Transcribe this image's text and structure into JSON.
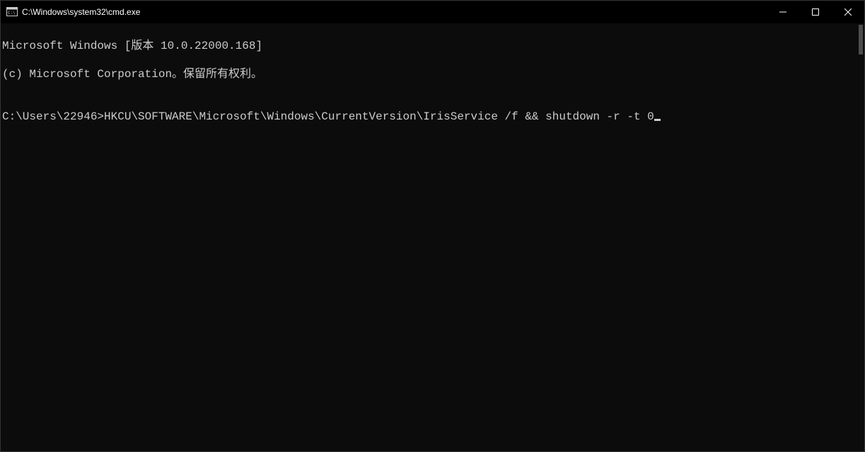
{
  "window": {
    "title": "C:\\Windows\\system32\\cmd.exe"
  },
  "terminal": {
    "line1": "Microsoft Windows [版本 10.0.22000.168]",
    "line2": "(c) Microsoft Corporation。保留所有权利。",
    "blank": "",
    "prompt": "C:\\Users\\22946>",
    "command": "HKCU\\SOFTWARE\\Microsoft\\Windows\\CurrentVersion\\IrisService /f && shutdown -r -t 0"
  }
}
